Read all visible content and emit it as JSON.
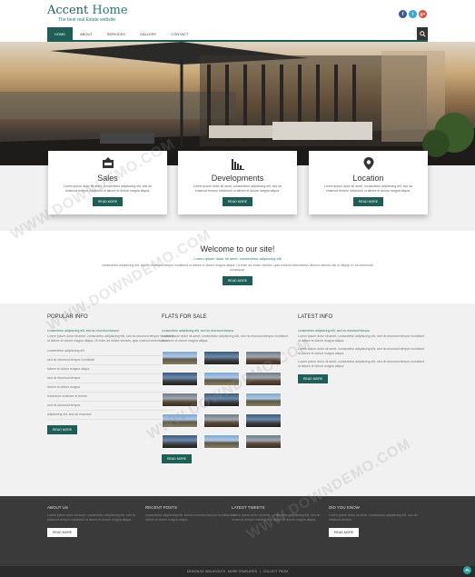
{
  "header": {
    "logo_title_1": "Accent",
    "logo_title_2": "Home",
    "logo_subtitle": "The best real Estate website",
    "social": [
      "f",
      "t",
      "g+"
    ]
  },
  "nav": {
    "items": [
      "HOME",
      "ABOUT",
      "SERVICES",
      "GALLERY",
      "CONTACT"
    ],
    "active_index": 0,
    "search_icon": "search-icon"
  },
  "features": [
    {
      "icon": "sale-tag-icon",
      "title": "Sales",
      "text": "Lorem ipsum dolor sit amet, consectetur adipisicing elit, sed do eiusmod tempor incididunt ut labore et dolore magna aliqua.",
      "button": "READ MORE"
    },
    {
      "icon": "bar-chart-icon",
      "title": "Developments",
      "text": "Lorem ipsum dolor sit amet, consectetur adipisicing elit, sed do eiusmod tempor incididunt ut labore et dolore magna aliqua.",
      "button": "READ MORE"
    },
    {
      "icon": "map-pin-icon",
      "title": "Location",
      "text": "Lorem ipsum dolor sit amet, consectetur adipisicing elit, sed do eiusmod tempor incididunt ut labore et dolore magna aliqua.",
      "button": "READ MORE"
    }
  ],
  "welcome": {
    "title": "Welcome to our site!",
    "subtitle": "Lorem ipsum dolor sit amet, consectetur adipiscing elit",
    "text": "consectetur adipisicing elit, sed do eiusmod tempor incididunt ut labore et dolore magna aliqua. Ut enim ad minim veniam, quis nostrud exercitation ullamco laboris nisi ut aliquip ex ea commodo consequat.",
    "button": "READ MORE"
  },
  "popular": {
    "title": "POPULAR INFO",
    "subtitle": "consectetur adipisicing elit, sed do eiusmod tempor",
    "text": "Lorem ipsum dolor sit amet, consectetur adipisicing elit, sed do eiusmod tempor incididunt ut labore et dolore magna aliqua, Ut enim ad minim veniam, quis nostrud exercitation.",
    "items": [
      "consectetur adipisicing elit",
      "sed do eiusmod tempor incididunt",
      "labore et dolore magna aliqua",
      "sed do eiusmod tempor",
      "dolore et dolore magna",
      "incididunt ut labore et dolore",
      "sed do eiusmod tempor",
      "adipisicing elit, sed do eiusmod"
    ],
    "button": "READ MORE"
  },
  "flats": {
    "title": "FLATS FOR SALE",
    "subtitle": "consectetur adipisicing elit, sed do eiusmod tempor",
    "text": "Lorem ipsum dolor sit amet, consectetur adipisicing elit, sed do eiusmod tempor incididunt ut labore et dolore magna aliqua.",
    "button": "READ MORE"
  },
  "latest": {
    "title": "LATEST INFO",
    "subtitle": "consectetur adipisicing elit, sed do eiusmod tempor",
    "text_1": "Lorem ipsum dolor sit amet, consectetur adipisicing elit, sed do eiusmod tempor incididunt ut labore et dolore magna aliqua.",
    "text_2": "Lorem ipsum dolor sit amet, consectetur adipisicing elit, sed do eiusmod tempor incididunt ut labore et dolore magna aliqua.",
    "text_3": "Lorem ipsum dolor sit amet, consectetur adipisicing elit, sed do eiusmod tempor incididunt ut labore et dolore magna aliqua.",
    "button": "READ MORE"
  },
  "footer": {
    "about_title": "ABOUT US",
    "about_text": "Lorem ipsum dolor sit amet, consectetur adipisicing elit, sed do eiusmod tempor incididunt ut labore et dolore magna aliqua.",
    "about_button": "READ MORE",
    "posts_title": "RECENT POSTS",
    "posts_text": "consectetur adipisicing elit, sed do eiusmod tempor incididunt ut labore et dolore magna aliqua.",
    "tweets_title": "LATEST TWEETS",
    "tweets_text": "Lorem ipsum dolor sit amet, consectetur adipisicing elit, sed do eiusmod tempor incididunt ut labore et dolore magna aliqua.",
    "know_title": "DID YOU KNOW",
    "know_text": "Lorem ipsum dolor sit amet, consectetur adipisicing elit, sed do eiusmod tempor.",
    "know_button": "READ MORE",
    "copyright_left": "DESIGN BY WGLAYOUTS . MORE TEMPLATES",
    "copyright_right": "COLLECT FROM"
  },
  "colors": {
    "brand": "#1d5e57",
    "accent": "#2a7a71",
    "footer_bg": "#3a3a3a"
  }
}
